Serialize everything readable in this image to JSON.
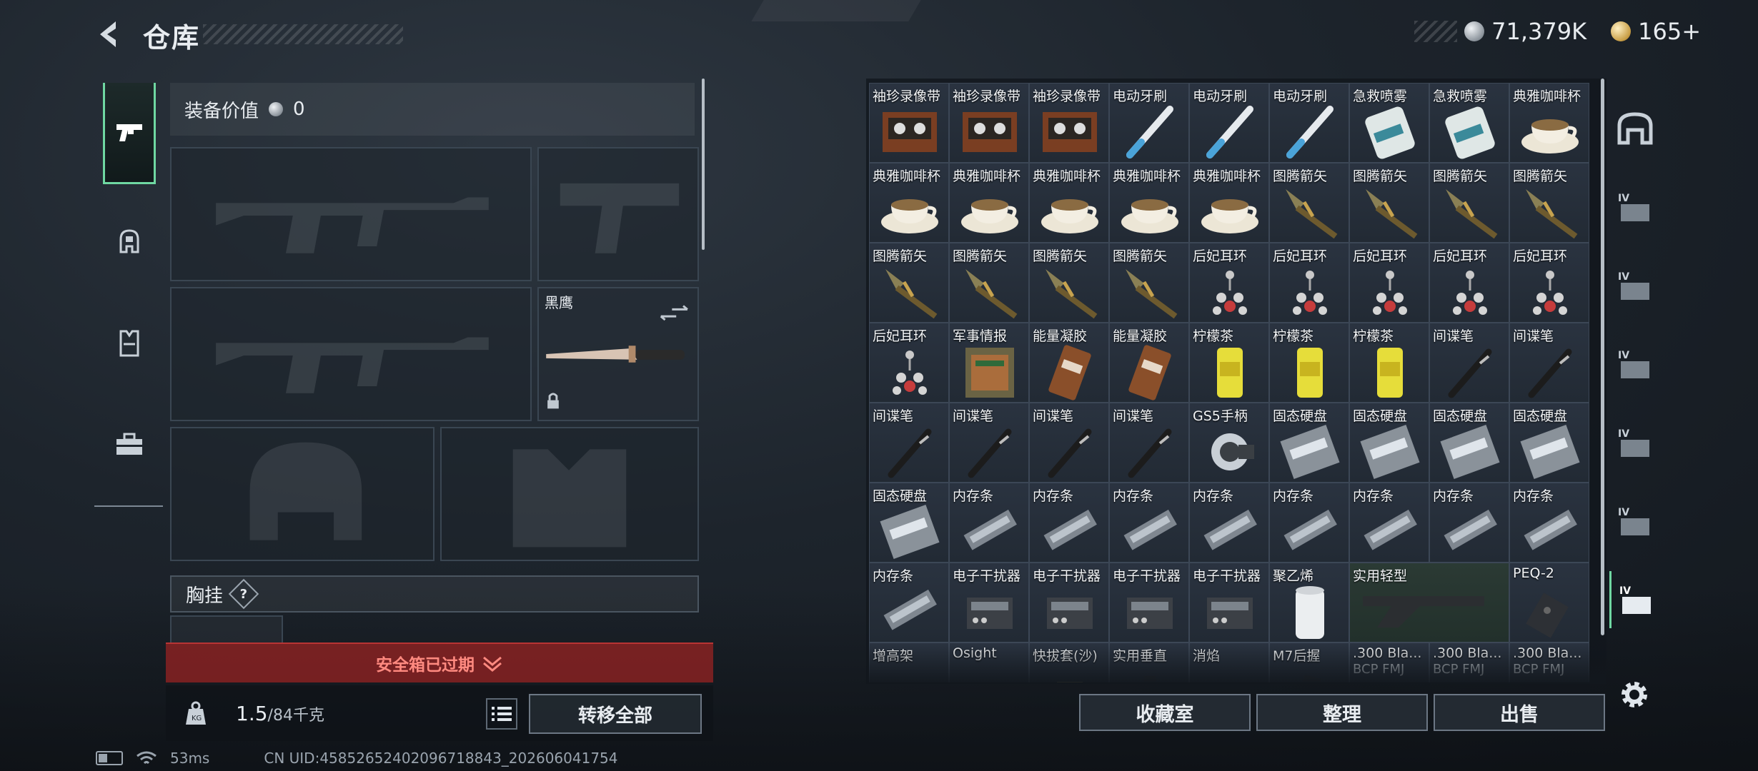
{
  "header": {
    "title": "仓库",
    "silver_amount": "71,379K",
    "gold_amount": "165+"
  },
  "left": {
    "equip_value_label": "装备价值",
    "equip_value": "0",
    "knife_slot_label": "黑鹰",
    "chest_label": "胸挂",
    "chest_help": "?",
    "safe_box_status": "安全箱已过期",
    "weight_current": "1.5",
    "weight_capacity": "/84千克",
    "transfer_all": "转移全部"
  },
  "grid": {
    "items": [
      "袖珍录像带",
      "袖珍录像带",
      "袖珍录像带",
      "电动牙刷",
      "电动牙刷",
      "电动牙刷",
      "急救喷雾",
      "急救喷雾",
      "典雅咖啡杯",
      "典雅咖啡杯",
      "典雅咖啡杯",
      "典雅咖啡杯",
      "典雅咖啡杯",
      "典雅咖啡杯",
      "图腾箭矢",
      "图腾箭矢",
      "图腾箭矢",
      "图腾箭矢",
      "图腾箭矢",
      "图腾箭矢",
      "图腾箭矢",
      "图腾箭矢",
      "后妃耳环",
      "后妃耳环",
      "后妃耳环",
      "后妃耳环",
      "后妃耳环",
      "后妃耳环",
      "军事情报",
      "能量凝胶",
      "能量凝胶",
      "柠檬茶",
      "柠檬茶",
      "柠檬茶",
      "间谍笔",
      "间谍笔",
      "间谍笔",
      "间谍笔",
      "间谍笔",
      "间谍笔",
      "GS5手柄",
      "固态硬盘",
      "固态硬盘",
      "固态硬盘",
      "固态硬盘",
      "固态硬盘",
      "内存条",
      "内存条",
      "内存条",
      "内存条",
      "内存条",
      "内存条",
      "内存条",
      "内存条",
      "内存条",
      "电子干扰器",
      "电子干扰器",
      "电子干扰器",
      "电子干扰器",
      "聚乙烯",
      "实用轻型",
      "PEQ-2",
      "增高架",
      "Osight",
      "快拔套(沙)",
      "实用垂直",
      "消焰",
      "M7后握",
      ".300 Bla...",
      ".300 Bla...",
      ".300 Bla..."
    ],
    "subs": [
      "BCP FMJ",
      "BCP FMJ",
      "BCP FMJ"
    ]
  },
  "bottom": {
    "collection": "收藏室",
    "organize": "整理",
    "sell": "出售"
  },
  "status": {
    "ping": "53ms",
    "uid": "CN UID:458526524020967188​43_202606041754"
  },
  "icons": [
    "pistol-icon",
    "backpack-icon",
    "chest-rig-icon",
    "case-icon",
    "home-icon",
    "storage-iv-icon"
  ]
}
